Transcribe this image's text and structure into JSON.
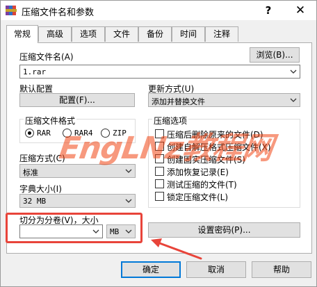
{
  "window": {
    "title": "压缩文件名和参数",
    "help_glyph": "?",
    "close_glyph": "✕"
  },
  "tabs": [
    "常规",
    "高级",
    "选项",
    "文件",
    "备份",
    "时间",
    "注释"
  ],
  "archive_name": {
    "label": "压缩文件名(A)",
    "browse_label": "浏览(B)...",
    "value": "1.rar"
  },
  "profiles": {
    "label": "默认配置",
    "button_label": "配置(F)..."
  },
  "update_mode": {
    "label": "更新方式(U)",
    "value": "添加并替换文件"
  },
  "archive_format": {
    "label": "压缩文件格式",
    "options": [
      "RAR",
      "RAR4",
      "ZIP"
    ],
    "selected": "RAR"
  },
  "compression_method": {
    "label": "压缩方式(C)",
    "value": "标准"
  },
  "dictionary_size": {
    "label": "字典大小(I)",
    "value": "32 MB"
  },
  "split_volumes": {
    "label": "切分为分卷(V)，大小",
    "value": "",
    "unit": "MB"
  },
  "archive_options": {
    "label": "压缩选项",
    "items": [
      {
        "label": "压缩后删除原来的文件(D)",
        "checked": false
      },
      {
        "label": "创建自解压格式压缩文件(X)",
        "checked": false
      },
      {
        "label": "创建固实压缩文件(S)",
        "checked": false
      },
      {
        "label": "添加恢复记录(E)",
        "checked": false
      },
      {
        "label": "测试压缩的文件(T)",
        "checked": false
      },
      {
        "label": "锁定压缩文件(L)",
        "checked": false
      }
    ]
  },
  "set_password": {
    "label": "设置密码(P)..."
  },
  "watermark": {
    "text": "EngLNz教程网"
  },
  "footer": {
    "ok": "确定",
    "cancel": "取消",
    "help": "帮助"
  },
  "colors": {
    "accent": "#0078d7",
    "annotation": "#e8443a",
    "watermark": "#f04614"
  }
}
